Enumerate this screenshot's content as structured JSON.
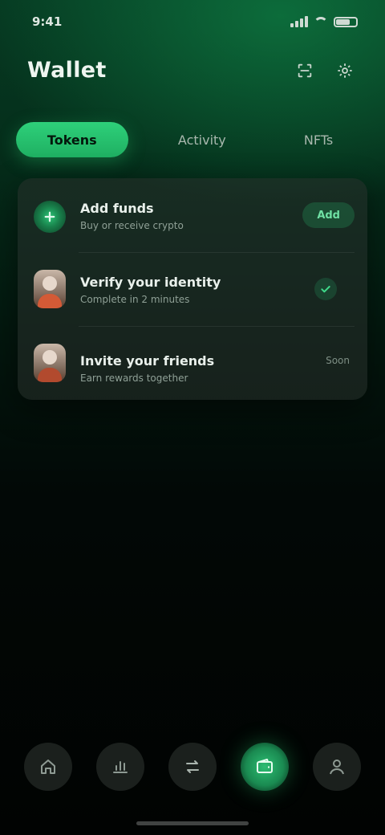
{
  "status_bar": {
    "time": "9:41"
  },
  "header": {
    "title": "Wallet",
    "actions": [
      {
        "icon": "scan-icon"
      },
      {
        "icon": "settings-icon"
      }
    ]
  },
  "tabs": [
    {
      "label": "Tokens",
      "active": true
    },
    {
      "label": "Activity",
      "active": false
    },
    {
      "label": "NFTs",
      "active": false
    }
  ],
  "list": [
    {
      "title": "Add funds",
      "subtitle": "Buy or receive crypto",
      "action_label": "Add"
    },
    {
      "title": "Verify your identity",
      "subtitle": "Complete in 2 minutes"
    },
    {
      "title": "Invite your friends",
      "subtitle": "Earn rewards together",
      "meta": "Soon"
    }
  ],
  "bottom_nav": [
    {
      "icon": "home-icon",
      "active": false
    },
    {
      "icon": "chart-icon",
      "active": false
    },
    {
      "icon": "swap-icon",
      "active": false
    },
    {
      "icon": "wallet-icon",
      "active": true
    },
    {
      "icon": "profile-icon",
      "active": false
    }
  ],
  "colors": {
    "accent": "#2ed07a",
    "background_top": "#063a22",
    "background_bottom": "#010302"
  }
}
